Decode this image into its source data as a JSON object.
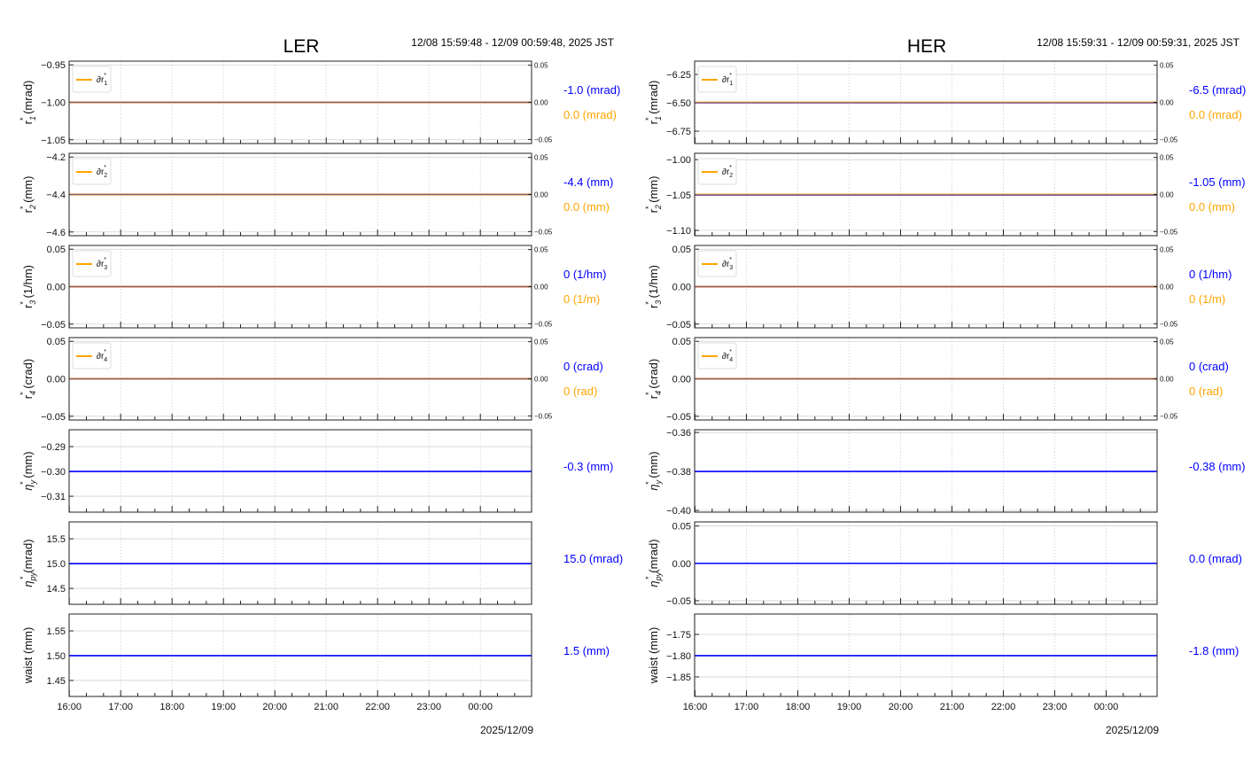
{
  "colors": {
    "main_series": "#0000ff",
    "delta_series": "#ffa500",
    "grid": "#d0d0d0",
    "axis": "#222222"
  },
  "chart_data": [
    {
      "type": "line",
      "title": "LER",
      "time_range": "12/08 15:59:48 - 12/09 00:59:48, 2025 JST",
      "date_label": "2025/12/09",
      "xlim": [
        "15:59:48",
        "00:59:48"
      ],
      "x_ticks": [
        "16:00",
        "17:00",
        "18:00",
        "19:00",
        "20:00",
        "21:00",
        "22:00",
        "23:00",
        "00:00"
      ],
      "grid": true,
      "panels": [
        {
          "ylabel": {
            "sym": "r",
            "sub": "1",
            "unit": "(mrad)"
          },
          "ylim": [
            -1.055,
            -0.945
          ],
          "yticks": [
            "-0.95",
            "-1.00",
            "-1.05"
          ],
          "y": [
            -1.0,
            -1.0
          ],
          "legend": {
            "sym": "∂r",
            "sub": "1"
          },
          "right_ylim": [
            -0.05,
            0.05
          ],
          "right_ticks": [
            "0.05",
            "0.00",
            "-0.05"
          ],
          "delta_y": [
            0,
            0
          ],
          "readout": "-1.0 (mrad)",
          "delta_readout": "0.0 (mrad)"
        },
        {
          "ylabel": {
            "sym": "r",
            "sub": "2",
            "unit": "(mm)"
          },
          "ylim": [
            -4.62,
            -4.18
          ],
          "yticks": [
            "-4.2",
            "-4.4",
            "-4.6"
          ],
          "y": [
            -4.4,
            -4.4
          ],
          "legend": {
            "sym": "∂r",
            "sub": "2"
          },
          "right_ylim": [
            -0.05,
            0.05
          ],
          "right_ticks": [
            "0.05",
            "0.00",
            "-0.05"
          ],
          "delta_y": [
            0,
            0
          ],
          "readout": "-4.4 (mm)",
          "delta_readout": "0.0 (mm)"
        },
        {
          "ylabel": {
            "sym": "r",
            "sub": "3",
            "unit": "(1/hm)"
          },
          "ylim": [
            -0.055,
            0.055
          ],
          "yticks": [
            "0.05",
            "0.00",
            "-0.05"
          ],
          "y": [
            0,
            0
          ],
          "legend": {
            "sym": "∂r",
            "sub": "3"
          },
          "right_ylim": [
            -0.05,
            0.05
          ],
          "right_ticks": [
            "0.05",
            "0.00",
            "-0.05"
          ],
          "delta_y": [
            0,
            0
          ],
          "readout": "0 (1/hm)",
          "delta_readout": "0 (1/m)"
        },
        {
          "ylabel": {
            "sym": "r",
            "sub": "4",
            "unit": "(crad)"
          },
          "ylim": [
            -0.055,
            0.055
          ],
          "yticks": [
            "0.05",
            "0.00",
            "-0.05"
          ],
          "y": [
            0,
            0
          ],
          "legend": {
            "sym": "∂r",
            "sub": "4"
          },
          "right_ylim": [
            -0.05,
            0.05
          ],
          "right_ticks": [
            "0.05",
            "0.00",
            "-0.05"
          ],
          "delta_y": [
            0,
            0
          ],
          "readout": "0 (crad)",
          "delta_readout": "0 (rad)"
        },
        {
          "ylabel": {
            "sym": "η",
            "sub": "y",
            "unit": "(mm)"
          },
          "ylim": [
            -0.3164,
            -0.2832
          ],
          "yticks": [
            "-0.29",
            "-0.30",
            "-0.31"
          ],
          "y": [
            -0.3,
            -0.3
          ],
          "readout": "-0.3 (mm)"
        },
        {
          "ylabel": {
            "sym": "η",
            "sub": "py",
            "unit": "(mrad)"
          },
          "ylim": [
            14.18,
            15.84
          ],
          "yticks": [
            "15.5",
            "15.0",
            "14.5"
          ],
          "y": [
            15.0,
            15.0
          ],
          "readout": "15.0 (mrad)"
        },
        {
          "ylabel": {
            "sym": "waist",
            "sub": "",
            "unit": "(mm)"
          },
          "ylim": [
            1.4177,
            1.584
          ],
          "yticks": [
            "1.55",
            "1.50",
            "1.45"
          ],
          "y": [
            1.5,
            1.5
          ],
          "readout": "1.5 (mm)"
        }
      ]
    },
    {
      "type": "line",
      "title": "HER",
      "time_range": "12/08 15:59:31 - 12/09 00:59:31, 2025 JST",
      "date_label": "2025/12/09",
      "xlim": [
        "15:59:31",
        "00:59:31"
      ],
      "x_ticks": [
        "16:00",
        "17:00",
        "18:00",
        "19:00",
        "20:00",
        "21:00",
        "22:00",
        "23:00",
        "00:00"
      ],
      "grid": true,
      "panels": [
        {
          "ylabel": {
            "sym": "r",
            "sub": "1",
            "unit": "(mrad)"
          },
          "ylim": [
            -6.859,
            -6.133
          ],
          "yticks": [
            "-6.25",
            "-6.50",
            "-6.75"
          ],
          "y": [
            -6.5,
            -6.5
          ],
          "legend": {
            "sym": "∂r",
            "sub": "1"
          },
          "right_ylim": [
            -0.05,
            0.05
          ],
          "right_ticks": [
            "0.05",
            "0.00",
            "-0.05"
          ],
          "delta_y": [
            0,
            0
          ],
          "readout": "-6.5 (mrad)",
          "delta_readout": "0.0 (mrad)"
        },
        {
          "ylabel": {
            "sym": "r",
            "sub": "2",
            "unit": "(mm)"
          },
          "ylim": [
            -1.1075,
            -0.991
          ],
          "yticks": [
            "-1.00",
            "-1.05",
            "-1.10"
          ],
          "y": [
            -1.05,
            -1.05
          ],
          "legend": {
            "sym": "∂r",
            "sub": "2"
          },
          "right_ylim": [
            -0.05,
            0.05
          ],
          "right_ticks": [
            "0.05",
            "0.00",
            "-0.05"
          ],
          "delta_y": [
            0,
            0
          ],
          "readout": "-1.05 (mm)",
          "delta_readout": "0.0 (mm)"
        },
        {
          "ylabel": {
            "sym": "r",
            "sub": "3",
            "unit": "(1/hm)"
          },
          "ylim": [
            -0.055,
            0.055
          ],
          "yticks": [
            "0.05",
            "0.00",
            "-0.05"
          ],
          "y": [
            0,
            0
          ],
          "legend": {
            "sym": "∂r",
            "sub": "3"
          },
          "right_ylim": [
            -0.05,
            0.05
          ],
          "right_ticks": [
            "0.05",
            "0.00",
            "-0.05"
          ],
          "delta_y": [
            0,
            0
          ],
          "readout": "0 (1/hm)",
          "delta_readout": "0 (1/m)"
        },
        {
          "ylabel": {
            "sym": "r",
            "sub": "4",
            "unit": "(crad)"
          },
          "ylim": [
            -0.055,
            0.055
          ],
          "yticks": [
            "0.05",
            "0.00",
            "-0.05"
          ],
          "y": [
            0,
            0
          ],
          "legend": {
            "sym": "∂r",
            "sub": "4"
          },
          "right_ylim": [
            -0.05,
            0.05
          ],
          "right_ticks": [
            "0.05",
            "0.00",
            "-0.05"
          ],
          "delta_y": [
            0,
            0
          ],
          "readout": "0 (crad)",
          "delta_readout": "0 (rad)"
        },
        {
          "ylabel": {
            "sym": "η",
            "sub": "y",
            "unit": "(mm)"
          },
          "ylim": [
            -0.4009,
            -0.3586
          ],
          "yticks": [
            "-0.36",
            "-0.38",
            "-0.40"
          ],
          "y": [
            -0.38,
            -0.38
          ],
          "readout": "-0.38 (mm)"
        },
        {
          "ylabel": {
            "sym": "η",
            "sub": "py",
            "unit": "(mrad)"
          },
          "ylim": [
            -0.0548,
            0.0554
          ],
          "yticks": [
            "0.05",
            "0.00",
            "-0.05"
          ],
          "y": [
            0.0,
            0.0
          ],
          "readout": "0.0 (mrad)"
        },
        {
          "ylabel": {
            "sym": "waist",
            "sub": "",
            "unit": "(mm)"
          },
          "ylim": [
            -1.896,
            -1.702
          ],
          "yticks": [
            "-1.75",
            "-1.80",
            "-1.85"
          ],
          "y": [
            -1.8,
            -1.8
          ],
          "readout": "-1.8 (mm)"
        }
      ]
    }
  ]
}
